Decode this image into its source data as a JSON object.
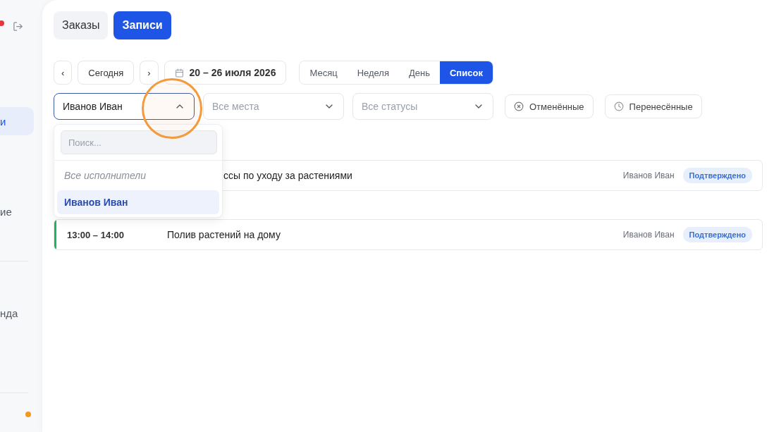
{
  "sidebar": {
    "items": [
      {
        "label": "и",
        "selected": true
      },
      {
        "label": "ие",
        "selected": false
      },
      {
        "label": "нда",
        "selected": false
      }
    ]
  },
  "tabs": [
    {
      "label": "Заказы",
      "selected": false
    },
    {
      "label": "Записи",
      "selected": true
    }
  ],
  "toolbar": {
    "prev": "‹",
    "today": "Сегодня",
    "next": "›",
    "date_range": "20 – 26 июля 2026",
    "views": [
      {
        "label": "Месяц",
        "selected": false
      },
      {
        "label": "Неделя",
        "selected": false
      },
      {
        "label": "День",
        "selected": false
      },
      {
        "label": "Список",
        "selected": true
      }
    ]
  },
  "filters": {
    "performer": {
      "value": "Иванов Иван",
      "expanded": true
    },
    "place": {
      "placeholder": "Все места"
    },
    "status": {
      "placeholder": "Все статусы"
    },
    "toggles": [
      {
        "label": "Отменённые",
        "kind": "cancelled"
      },
      {
        "label": "Перенесённые",
        "kind": "rescheduled"
      }
    ]
  },
  "performer_dropdown": {
    "search_placeholder": "Поиск...",
    "options": [
      {
        "label": "Все исполнители",
        "kind": "all",
        "selected": false
      },
      {
        "label": "Иванов Иван",
        "kind": "person",
        "selected": true
      }
    ]
  },
  "appointments": [
    {
      "title": "ссы по уходу за растениями",
      "performer": "Иванов Иван",
      "status": "Подтверждено"
    },
    {
      "time": "13:00 – 14:00",
      "title": "Полив растений на дому",
      "performer": "Иванов Иван",
      "status": "Подтверждено",
      "color": "#22b35e"
    }
  ]
}
